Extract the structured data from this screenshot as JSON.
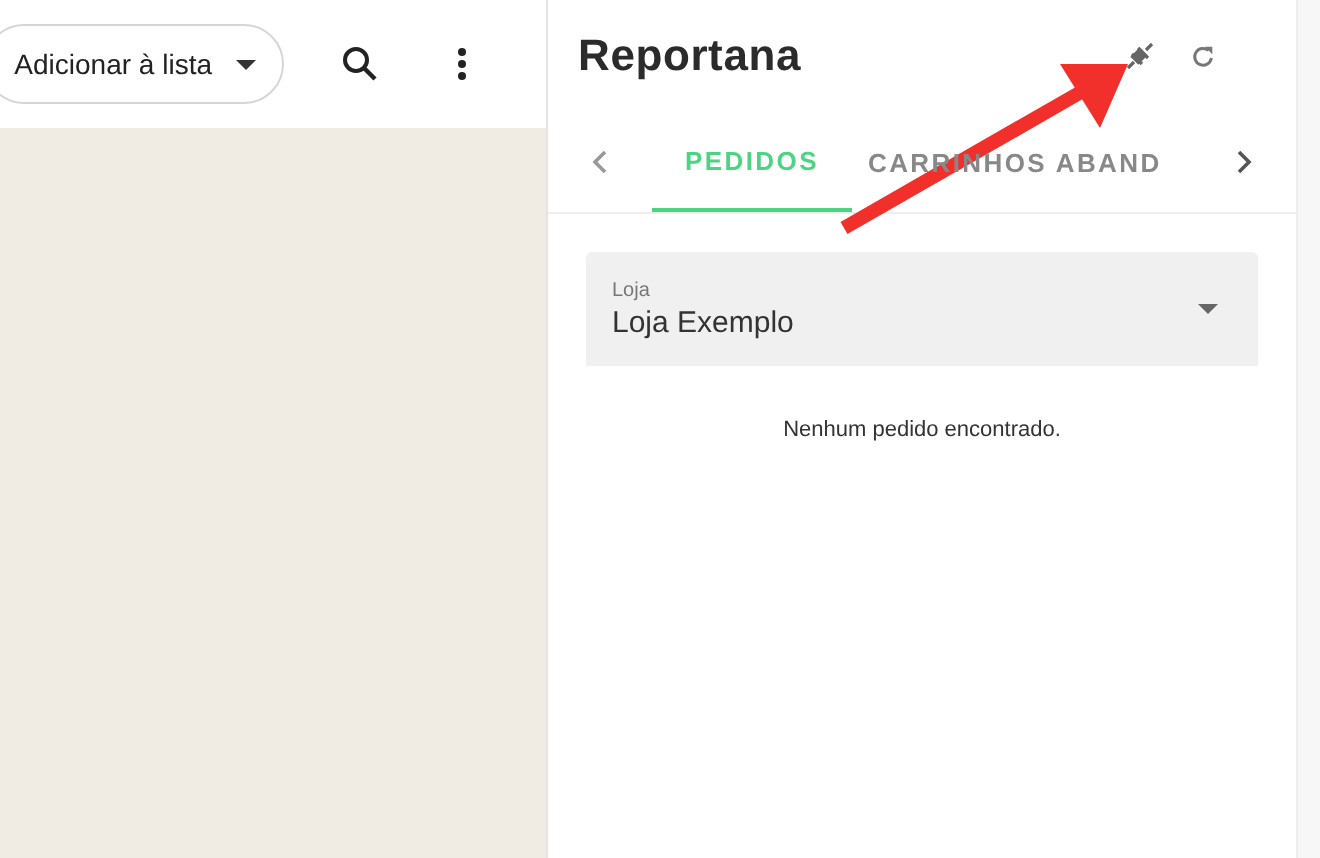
{
  "chat_header": {
    "list_button": {
      "label": "Adicionar à lista"
    }
  },
  "panel": {
    "logo": "Reportana",
    "tabs": [
      {
        "label": "PEDIDOS",
        "selected": true
      },
      {
        "label": "CARRINHOS ABAND",
        "selected": false
      }
    ],
    "store_select": {
      "label": "Loja",
      "value": "Loja Exemplo"
    },
    "empty_message": "Nenhum pedido encontrado."
  }
}
